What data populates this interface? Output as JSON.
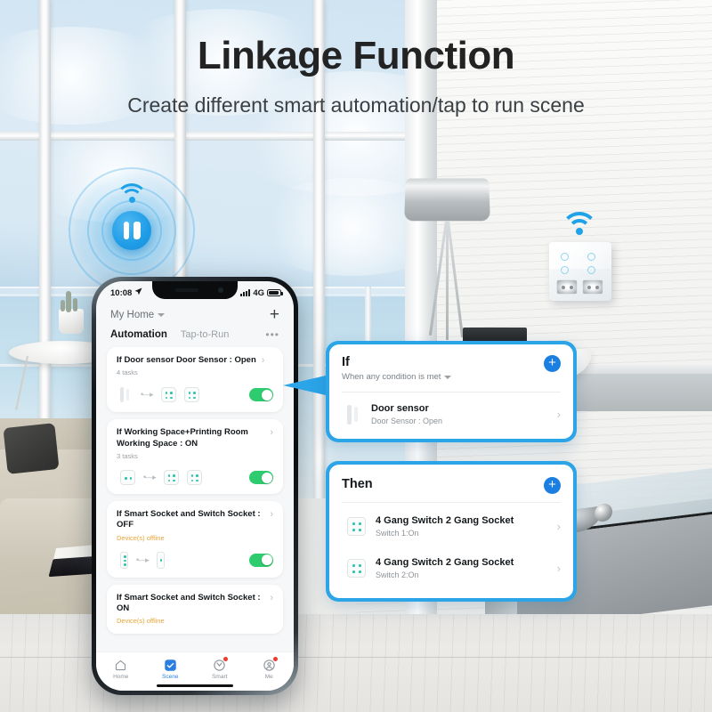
{
  "headline": {
    "title": "Linkage Function",
    "subtitle": "Create different smart automation/tap to run scene"
  },
  "colors": {
    "accent_blue": "#2ba4e8",
    "plus_blue": "#1a7fe0",
    "toggle_green": "#2ecc6e",
    "warning_amber": "#e8a53a",
    "tab_active_blue": "#2b7fe0"
  },
  "phone": {
    "status_bar": {
      "time": "10:08",
      "location_icon": "location-arrow-icon",
      "signal_icon": "cellular-signal-icon",
      "network": "4G",
      "battery_icon": "battery-icon"
    },
    "header": {
      "home_name": "My Home",
      "dropdown_icon": "chevron-down-icon",
      "add_icon": "plus-icon"
    },
    "tabs": [
      {
        "label": "Automation",
        "active": true
      },
      {
        "label": "Tap-to-Run",
        "active": false
      }
    ],
    "more_icon": "more-horizontal-icon",
    "automations": [
      {
        "title": "If Door sensor Door Sensor : Open",
        "subtitle": "4 tasks",
        "subtitle_warning": false,
        "chevron_icon": "chevron-right-icon",
        "enabled": true
      },
      {
        "title": "If Working Space+Printing Room Working Space : ON",
        "subtitle": "3 tasks",
        "subtitle_warning": false,
        "chevron_icon": "chevron-right-icon",
        "enabled": true
      },
      {
        "title": "If Smart Socket and Switch Socket : OFF",
        "subtitle": "Device(s) offline",
        "subtitle_warning": true,
        "chevron_icon": "chevron-right-icon",
        "enabled": true
      },
      {
        "title": "If Smart Socket and Switch Socket : ON",
        "subtitle": "Device(s) offline",
        "subtitle_warning": true,
        "chevron_icon": "chevron-right-icon",
        "enabled": true
      }
    ],
    "tabbar": [
      {
        "label": "Home",
        "icon": "home-icon",
        "active": false,
        "badge": false
      },
      {
        "label": "Scene",
        "icon": "scene-check-icon",
        "active": true,
        "badge": false
      },
      {
        "label": "Smart",
        "icon": "smart-clock-icon",
        "active": false,
        "badge": true
      },
      {
        "label": "Me",
        "icon": "profile-icon",
        "active": false,
        "badge": true
      }
    ]
  },
  "callouts": {
    "if_card": {
      "title": "If",
      "condition_mode": "When any condition is met",
      "dropdown_icon": "chevron-down-icon",
      "add_icon": "plus-icon",
      "rows": [
        {
          "icon": "door-sensor-icon",
          "title": "Door sensor",
          "subtitle": "Door Sensor : Open",
          "chevron_icon": "chevron-right-icon"
        }
      ]
    },
    "then_card": {
      "title": "Then",
      "add_icon": "plus-icon",
      "rows": [
        {
          "icon": "gang-switch-icon",
          "title": "4 Gang Switch 2 Gang Socket",
          "subtitle": "Switch 1:On",
          "chevron_icon": "chevron-right-icon"
        },
        {
          "icon": "gang-switch-icon",
          "title": "4 Gang Switch 2 Gang Socket",
          "subtitle": "Switch 2:On",
          "chevron_icon": "chevron-right-icon"
        }
      ]
    }
  },
  "scene": {
    "door_sensor_device_icon": "door-sensor-device-icon",
    "wall_switch_icon": "wall-switch-socket-icon",
    "wifi_icon": "wifi-icon"
  }
}
